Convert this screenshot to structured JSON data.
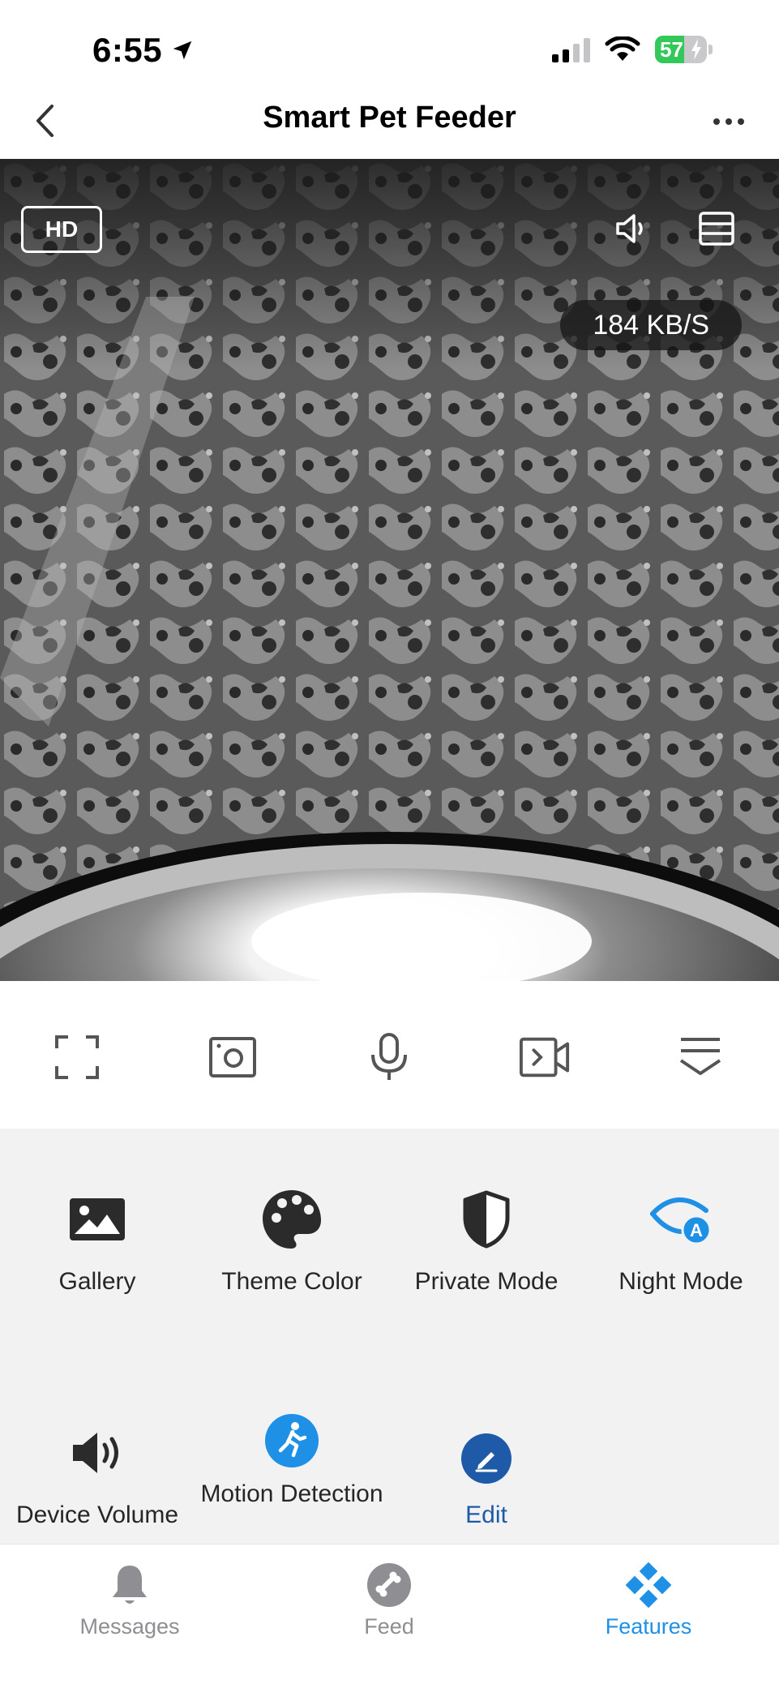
{
  "status_bar": {
    "time": "6:55",
    "battery": "57"
  },
  "header": {
    "title": "Smart Pet Feeder"
  },
  "camera": {
    "quality": "HD",
    "speed": "184 KB/S"
  },
  "features": {
    "row1": [
      {
        "label": "Gallery",
        "icon": "gallery-icon"
      },
      {
        "label": "Theme Color",
        "icon": "palette-icon"
      },
      {
        "label": "Private Mode",
        "icon": "shield-icon"
      },
      {
        "label": "Night Mode",
        "icon": "night-mode-icon"
      }
    ],
    "row2": [
      {
        "label": "Device Volume",
        "icon": "speaker-icon"
      },
      {
        "label": "Motion Detection",
        "icon": "motion-detection-icon"
      },
      {
        "label": "Edit",
        "icon": "edit-icon"
      }
    ]
  },
  "tabs": [
    {
      "label": "Messages",
      "icon": "bell-icon"
    },
    {
      "label": "Feed",
      "icon": "bone-icon"
    },
    {
      "label": "Features",
      "icon": "features-icon"
    }
  ],
  "colors": {
    "accent": "#1e90e6",
    "edit_blue": "#1e5aa8",
    "battery_green": "#34c759"
  }
}
